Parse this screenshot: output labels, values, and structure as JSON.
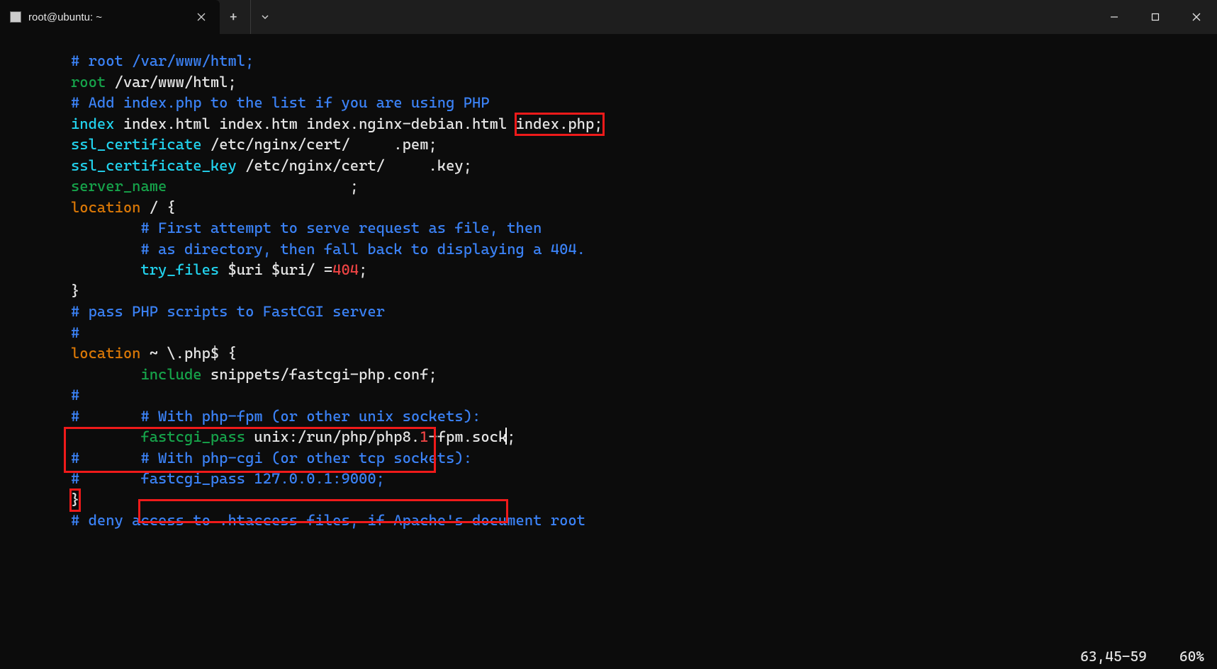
{
  "window": {
    "tab_title": "root@ubuntu: ~",
    "new_tab_label": "+",
    "dropdown_label": "⌄",
    "minimize": "—",
    "maximize": "□",
    "close": "✕"
  },
  "status": {
    "position": "63,45-59",
    "scroll": "60%"
  },
  "code": {
    "l1": "# root /var/www/html;",
    "l2a": "root",
    "l2b": " /var/www/html;",
    "l3": "",
    "l4": "# Add index.php to the list if you are using PHP",
    "l5a": "index",
    "l5b": " index.html index.htm index.nginx-debian.html ",
    "l5c": "index.php;",
    "l6": "",
    "l7a": "ssl_certificate",
    "l7b": " /etc/nginx/cert/     .pem;",
    "l8a": "ssl_certificate_key",
    "l8b": " /etc/nginx/cert/     .key;",
    "l9a": "server_name",
    "l9b": "                     ;",
    "l10": "",
    "l11a": "location",
    "l11b": " / {",
    "l12": "        # First attempt to serve request as file, then",
    "l13": "        # as directory, then fall back to displaying a 404.",
    "l14a": "        ",
    "l14b": "try_files",
    "l14c": " $uri $uri/ =",
    "l14d": "404",
    "l14e": ";",
    "l15": "}",
    "l16": "",
    "l17": "# pass PHP scripts to FastCGI server",
    "l18": "#",
    "l19a": "location",
    "l19b": " ~ \\.php$ {",
    "l20a": "        ",
    "l20b": "include",
    "l20c": " snippets/fastcgi-php.conf;",
    "l21": "#",
    "l22": "#       # With php-fpm (or other unix sockets):",
    "l23a": "        ",
    "l23b": "fastcgi_pass",
    "l23c": " unix:/run/php/php8.",
    "l23d": "1",
    "l23e": "-fpm.sock",
    "l23f": ";",
    "l24": "#       # With php-cgi (or other tcp sockets):",
    "l25": "#       fastcgi_pass 127.0.0.1:9000;",
    "l26": "}",
    "l27": "",
    "l28": "# deny access to .htaccess files, if Apache's document root"
  }
}
